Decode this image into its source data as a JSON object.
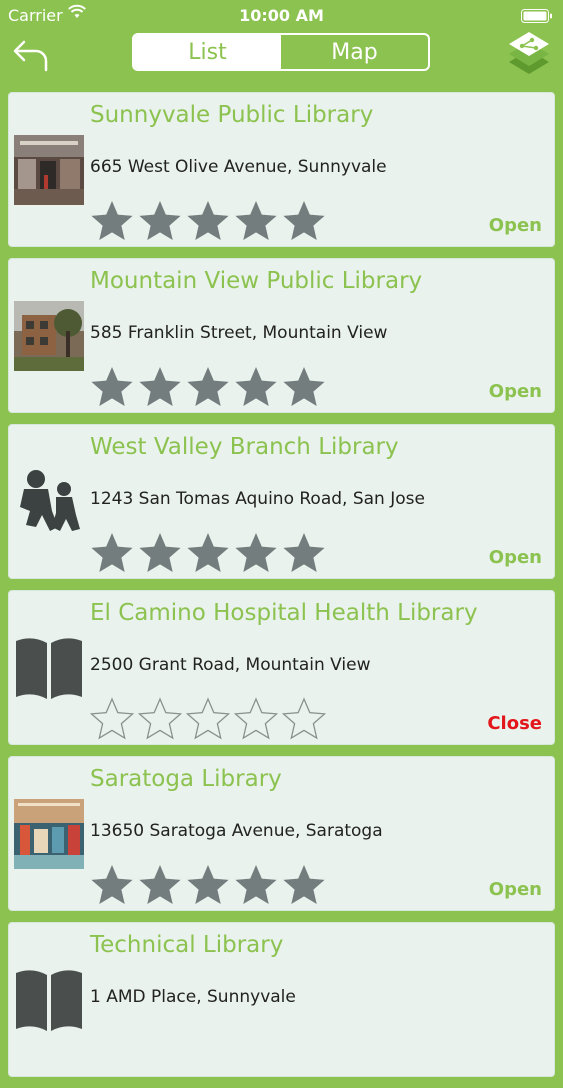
{
  "status_bar": {
    "carrier": "Carrier",
    "time": "10:00 AM"
  },
  "nav": {
    "segments": [
      "List",
      "Map"
    ],
    "selected": "List",
    "back_icon": "back-arrow-icon",
    "share_icon": "share-icon"
  },
  "colors": {
    "brand_green": "#8cc24f",
    "card_bg": "#e9f2ec",
    "open": "#8cc24f",
    "close": "#e3161b",
    "star": "#747d7d"
  },
  "libraries": [
    {
      "name": "Sunnyvale Public Library",
      "address": "665 West Olive Avenue, Sunnyvale",
      "rating": 5,
      "status": "Open"
    },
    {
      "name": "Mountain View Public Library",
      "address": "585 Franklin Street, Mountain View",
      "rating": 5,
      "status": "Open"
    },
    {
      "name": "West Valley Branch Library",
      "address": "1243 San Tomas Aquino Road, San Jose",
      "rating": 5,
      "status": "Open"
    },
    {
      "name": "El Camino Hospital Health Library",
      "address": "2500 Grant Road, Mountain View",
      "rating": 0,
      "status": "Close"
    },
    {
      "name": "Saratoga Library",
      "address": "13650 Saratoga Avenue, Saratoga",
      "rating": 5,
      "status": "Open"
    },
    {
      "name": "Technical Library",
      "address": "1 AMD Place, Sunnyvale",
      "rating": 0,
      "status": ""
    }
  ]
}
